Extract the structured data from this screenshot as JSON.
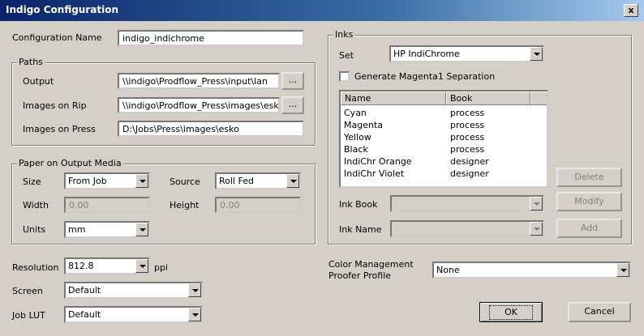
{
  "window": {
    "title": "Indigo Configuration",
    "close_label": "x"
  },
  "config_name": {
    "label": "Configuration Name",
    "value": "indigo_indichrome"
  },
  "paths": {
    "legend": "Paths",
    "output": {
      "label": "Output",
      "value": "\\\\indigo\\Prodflow_Press\\input\\lan",
      "browse": "..."
    },
    "images_on_rip": {
      "label": "Images on Rip",
      "value": "\\\\indigo\\Prodflow_Press\\images\\esko",
      "browse": "..."
    },
    "images_on_press": {
      "label": "Images on Press",
      "value": "D:\\Jobs\\Press\\images\\esko"
    }
  },
  "paper": {
    "legend": "Paper on Output Media",
    "size": {
      "label": "Size",
      "value": "From Job"
    },
    "source": {
      "label": "Source",
      "value": "Roll Fed"
    },
    "width": {
      "label": "Width",
      "value": "0.00"
    },
    "height": {
      "label": "Height",
      "value": "0.00"
    },
    "units": {
      "label": "Units",
      "value": "mm"
    }
  },
  "resolution": {
    "label": "Resolution",
    "value": "812.8",
    "unit": "ppi"
  },
  "screen": {
    "label": "Screen",
    "value": "Default"
  },
  "job_lut": {
    "label": "Job LUT",
    "value": "Default"
  },
  "inks": {
    "legend": "Inks",
    "set": {
      "label": "Set",
      "value": "HP IndiChrome"
    },
    "magenta1": {
      "label": "Generate Magenta1 Separation",
      "checked": false
    },
    "table": {
      "columns": [
        "Name",
        "Book"
      ],
      "rows": [
        {
          "name": "Cyan",
          "book": "process"
        },
        {
          "name": "Magenta",
          "book": "process"
        },
        {
          "name": "Yellow",
          "book": "process"
        },
        {
          "name": "Black",
          "book": "process"
        },
        {
          "name": "IndiChr Orange",
          "book": "designer"
        },
        {
          "name": "IndiChr Violet",
          "book": "designer"
        }
      ]
    },
    "delete_label": "Delete",
    "modify_label": "Modify",
    "add_label": "Add",
    "ink_book": {
      "label": "Ink Book",
      "value": ""
    },
    "ink_name": {
      "label": "Ink Name",
      "value": ""
    }
  },
  "color_mgmt": {
    "label_line1": "Color Management",
    "label_line2": "Proofer Profile",
    "value": "None"
  },
  "buttons": {
    "ok": "OK",
    "cancel": "Cancel"
  }
}
